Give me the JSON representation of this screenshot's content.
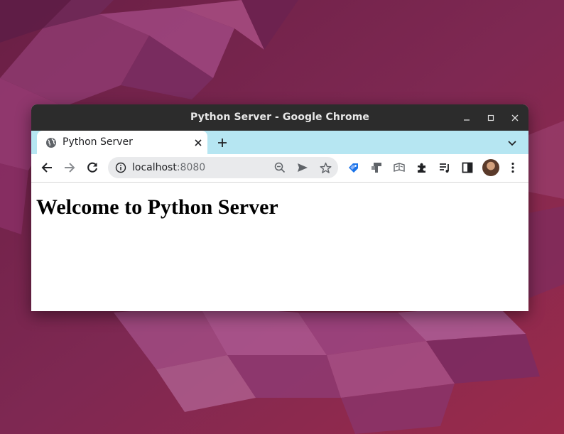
{
  "colors": {
    "wallpaper": "#7a2650",
    "titlebar": "#2c2c2c",
    "tabstrip": "#b6e6f2",
    "omnibox": "#e9eaec"
  },
  "window": {
    "title": "Python Server - Google Chrome",
    "controls": [
      "minimize-icon",
      "maximize-icon",
      "close-icon"
    ]
  },
  "tabs": [
    {
      "title": "Python Server",
      "favicon": "globe-icon",
      "active": true
    }
  ],
  "toolbar": {
    "url_host": "localhost",
    "url_port": ":8080",
    "icons": [
      "back-arrow-icon",
      "forward-arrow-icon",
      "reload-icon",
      "site-info-icon",
      "zoom-out-icon",
      "send-icon",
      "bookmark-star-icon",
      "extension-tag-icon",
      "extension-jira-icon",
      "extension-reader-icon",
      "extensions-puzzle-icon",
      "media-queue-icon",
      "side-panel-icon",
      "profile-avatar",
      "more-menu-icon"
    ]
  },
  "page": {
    "heading": "Welcome to Python Server"
  }
}
